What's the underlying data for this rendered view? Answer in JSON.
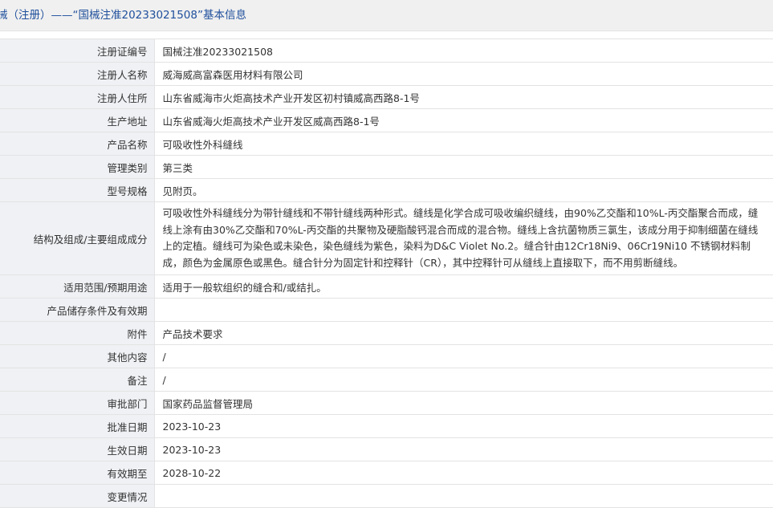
{
  "header": {
    "title": "械（注册）——“国械注准20233021508”基本信息"
  },
  "rows": [
    {
      "label": "注册证编号",
      "value": "国械注准20233021508"
    },
    {
      "label": "注册人名称",
      "value": "威海威高富森医用材料有限公司"
    },
    {
      "label": "注册人住所",
      "value": "山东省威海市火炬高技术产业开发区初村镇威高西路8-1号"
    },
    {
      "label": "生产地址",
      "value": "山东省威海火炬高技术产业开发区威高西路8-1号"
    },
    {
      "label": "产品名称",
      "value": "可吸收性外科缝线"
    },
    {
      "label": "管理类别",
      "value": "第三类"
    },
    {
      "label": "型号规格",
      "value": "见附页。"
    },
    {
      "label": "结构及组成/主要组成成分",
      "value": "可吸收性外科缝线分为带针缝线和不带针缝线两种形式。缝线是化学合成可吸收编织缝线，由90%乙交酯和10%L-丙交酯聚合而成，缝线上涂有由30%乙交酯和70%L-丙交酯的共聚物及硬脂酸钙混合而成的混合物。缝线上含抗菌物质三氯生，该成分用于抑制细菌在缝线上的定植。缝线可为染色或未染色，染色缝线为紫色，染料为D&C Violet No.2。缝合针由12Cr18Ni9、06Cr19Ni10 不锈钢材料制成，颜色为金属原色或黑色。缝合针分为固定针和控释针（CR），其中控释针可从缝线上直接取下，而不用剪断缝线。"
    },
    {
      "label": "适用范围/预期用途",
      "value": "适用于一般软组织的缝合和/或结扎。"
    },
    {
      "label": "产品储存条件及有效期",
      "value": ""
    },
    {
      "label": "附件",
      "value": "产品技术要求"
    },
    {
      "label": "其他内容",
      "value": "/"
    },
    {
      "label": "备注",
      "value": "/"
    },
    {
      "label": "审批部门",
      "value": "国家药品监督管理局"
    },
    {
      "label": "批准日期",
      "value": "2023-10-23"
    },
    {
      "label": "生效日期",
      "value": "2023-10-23"
    },
    {
      "label": "有效期至",
      "value": "2028-10-22"
    },
    {
      "label": "变更情况",
      "value": ""
    }
  ]
}
